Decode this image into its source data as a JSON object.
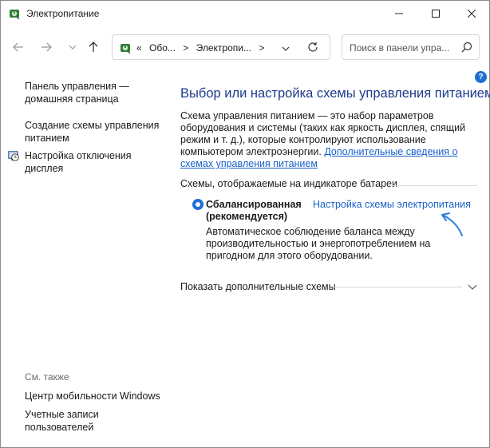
{
  "window": {
    "title": "Электропитание"
  },
  "nav": {
    "crumbs": [
      "«",
      "Обо...",
      ">",
      "Электропи...",
      ">"
    ],
    "search_placeholder": "Поиск в панели упра..."
  },
  "sidebar": {
    "home": "Панель управления — домашняя страница",
    "create_plan": "Создание схемы управления питанием",
    "display_off": "Настройка отключения дисплея",
    "see_also": "См. также",
    "mobility": "Центр мобильности Windows",
    "accounts": "Учетные записи пользователей"
  },
  "main": {
    "title": "Выбор или настройка схемы управления питанием",
    "description": "Схема управления питанием — это набор параметров оборудования и системы (таких как яркость дисплея, спящий режим и т. д.), которые контролируют использование компьютером электроэнергии.",
    "description_link": "Дополнительные сведения о схемах управления питанием",
    "section_label": "Схемы, отображаемые на индикаторе батареи",
    "plan_name": "Сбалансированная (рекомендуется)",
    "plan_link": "Настройка схемы электропитания",
    "plan_description": "Автоматическое соблюдение баланса между производительностью и энергопотреблением на пригодном для этого оборудовании.",
    "show_more": "Показать дополнительные схемы",
    "help": "?"
  },
  "colors": {
    "accent": "#1f6fd1",
    "link": "#1760c8",
    "heading": "#1d3a8a",
    "annotation_arrow": "#2b7fe0"
  },
  "icons": {
    "title": "power-options-icon",
    "address": "power-options-icon",
    "display_off": "clock-monitor-icon"
  }
}
